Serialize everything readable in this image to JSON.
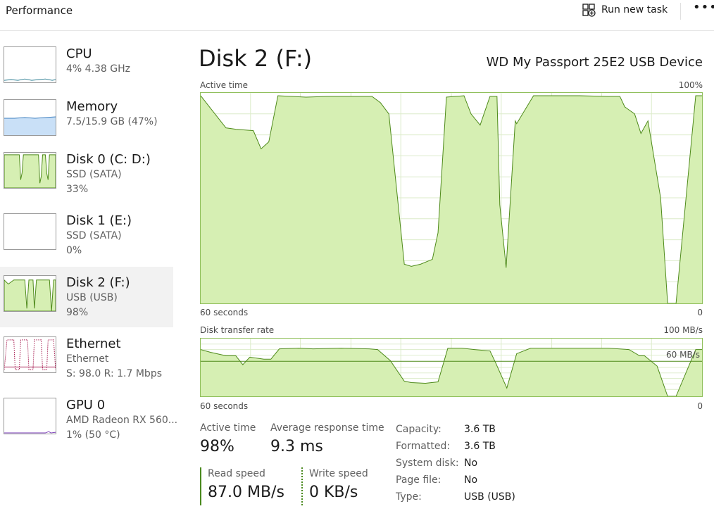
{
  "header": {
    "title": "Performance",
    "run_task_label": "Run new task",
    "more_label": "•••"
  },
  "sidebar": {
    "items": [
      {
        "name": "CPU",
        "line1": "4%  4.38 GHz",
        "line2": "",
        "line3": ""
      },
      {
        "name": "Memory",
        "line1": "7.5/15.9 GB (47%)",
        "line2": "",
        "line3": ""
      },
      {
        "name": "Disk 0 (C: D:)",
        "line1": "SSD (SATA)",
        "line2": "33%",
        "line3": ""
      },
      {
        "name": "Disk 1 (E:)",
        "line1": "SSD (SATA)",
        "line2": "0%",
        "line3": ""
      },
      {
        "name": "Disk 2 (F:)",
        "line1": "USB (USB)",
        "line2": "98%",
        "line3": ""
      },
      {
        "name": "Ethernet",
        "line1": "Ethernet",
        "line2": "S: 98.0  R: 1.7 Mbps",
        "line3": ""
      },
      {
        "name": "GPU 0",
        "line1": "AMD Radeon RX 560...",
        "line2": "1%  (50 °C)",
        "line3": ""
      }
    ],
    "selected_index": 4
  },
  "main": {
    "title": "Disk 2 (F:)",
    "device": "WD My Passport 25E2 USB Device",
    "active_chart": {
      "label": "Active time",
      "max_label": "100%",
      "time_label": "60 seconds",
      "min_label": "0"
    },
    "transfer_chart": {
      "label": "Disk transfer rate",
      "max_label": "100 MB/s",
      "ref_label": "60 MB/s",
      "time_label": "60 seconds",
      "min_label": "0"
    },
    "stats": {
      "active_time_label": "Active time",
      "active_time_value": "98%",
      "avg_response_label": "Average response time",
      "avg_response_value": "9.3 ms",
      "read_label": "Read speed",
      "read_value": "87.0 MB/s",
      "write_label": "Write speed",
      "write_value": "0 KB/s"
    },
    "properties": [
      {
        "key": "Capacity:",
        "value": "3.6 TB"
      },
      {
        "key": "Formatted:",
        "value": "3.6 TB"
      },
      {
        "key": "System disk:",
        "value": "No"
      },
      {
        "key": "Page file:",
        "value": "No"
      },
      {
        "key": "Type:",
        "value": "USB (USB)"
      }
    ]
  },
  "colors": {
    "disk_fill": "#d6efb3",
    "disk_line": "#4e8a1a",
    "grid": "#dcebc9",
    "memory_fill": "#c9e0f7",
    "memory_line": "#3d7fbf",
    "ethernet_line": "#a3124a",
    "gpu_line": "#7a3bb8",
    "cpu_line": "#2f7f94"
  }
}
